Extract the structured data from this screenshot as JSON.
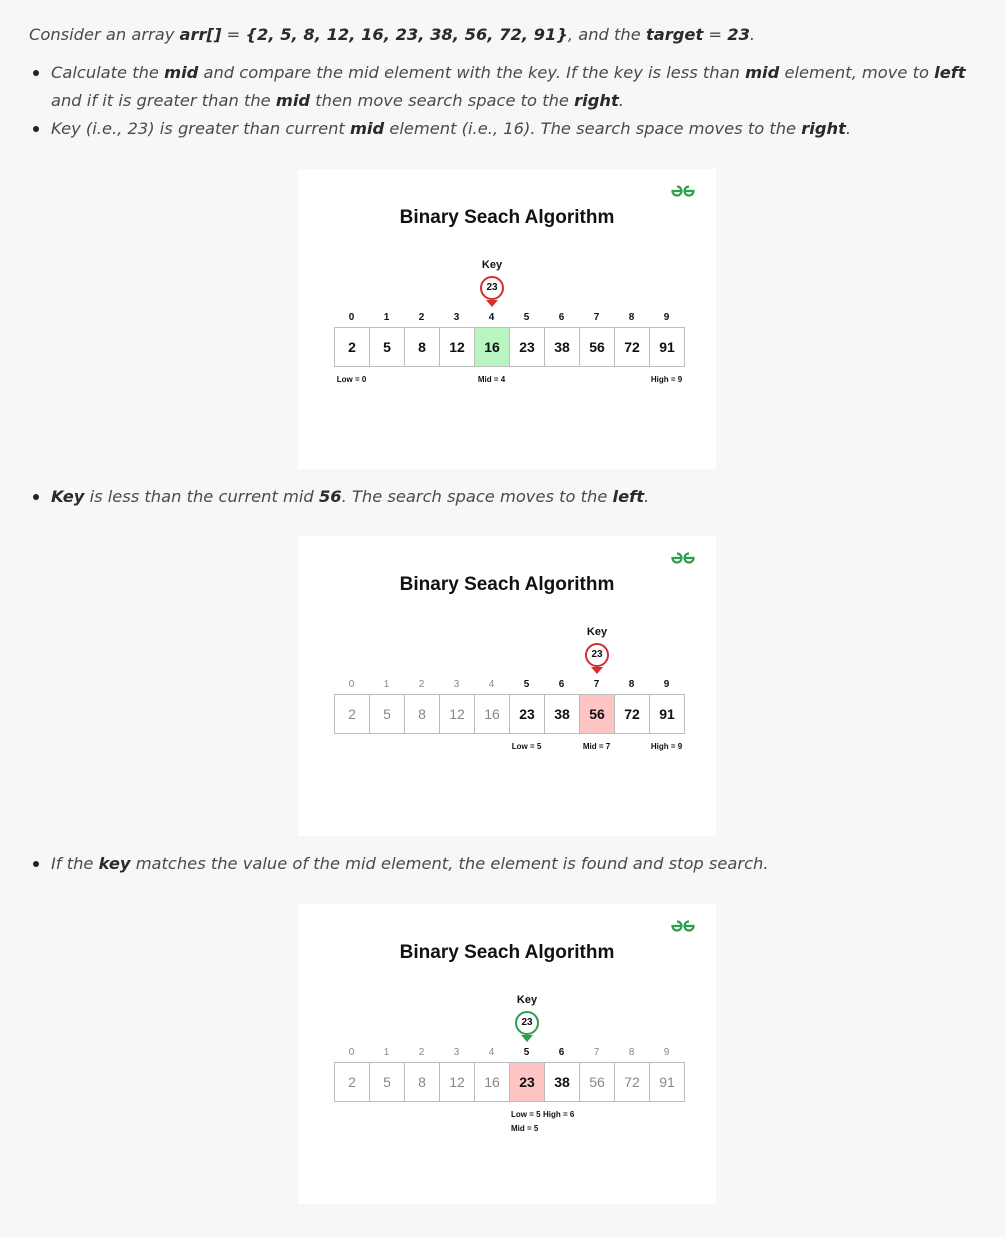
{
  "intro": {
    "p1": "Consider an array ",
    "arr_name": "arr[]",
    "p2": " = ",
    "arr_values": "{2, 5, 8, 12, 16, 23, 38, 56, 72, 91}",
    "p3": ", and the ",
    "target_word": "target",
    "p4": " = ",
    "target_value": "23",
    "p5": "."
  },
  "bullets1": [
    {
      "a": "Calculate the ",
      "b": "mid",
      "c": " and compare the mid element with the key. If the key is less than ",
      "d": "mid",
      "e": " element, move to ",
      "f": "left",
      "g": " and if it is greater than the ",
      "h": "mid",
      "i": " then move search space to the ",
      "j": "right",
      "k": "."
    },
    {
      "a": "Key (i.e., 23) is greater than current ",
      "b": "mid",
      "c": " element (i.e., 16). The search space moves to the ",
      "d": "right",
      "e": "."
    }
  ],
  "bullet2": {
    "a": "Key",
    "b": " is less than the current mid ",
    "c": "56",
    "d": ". The search space moves to the ",
    "e": "left",
    "f": "."
  },
  "bullet3": {
    "a": "If the ",
    "b": "key",
    "c": " matches the value of the mid element, the element is found and stop search."
  },
  "diagram": {
    "title": "Binary Seach Algorithm",
    "key_label": "Key",
    "key_value": "23",
    "indices": [
      "0",
      "1",
      "2",
      "3",
      "4",
      "5",
      "6",
      "7",
      "8",
      "9"
    ],
    "values": [
      "2",
      "5",
      "8",
      "12",
      "16",
      "23",
      "38",
      "56",
      "72",
      "91"
    ],
    "logo": "gfg-logo-icon",
    "accent_red": "#d32f2f",
    "accent_green": "#2e9e4f"
  },
  "steps": [
    {
      "key_index": 4,
      "mid_index": 4,
      "low": 0,
      "high": 9,
      "low_label": "Low = 0",
      "mid_label": "Mid = 4",
      "high_label": "High = 9",
      "highlight": "green",
      "key_color": "red"
    },
    {
      "key_index": 7,
      "mid_index": 7,
      "low": 5,
      "high": 9,
      "low_label": "Low = 5",
      "mid_label": "Mid = 7",
      "high_label": "High = 9",
      "highlight": "red",
      "key_color": "red"
    },
    {
      "key_index": 5,
      "mid_index": 5,
      "low": 5,
      "high": 6,
      "low_label": "Low = 5",
      "mid_label": "Mid = 5",
      "high_label": "High = 6",
      "highlight": "red",
      "key_color": "green"
    }
  ]
}
